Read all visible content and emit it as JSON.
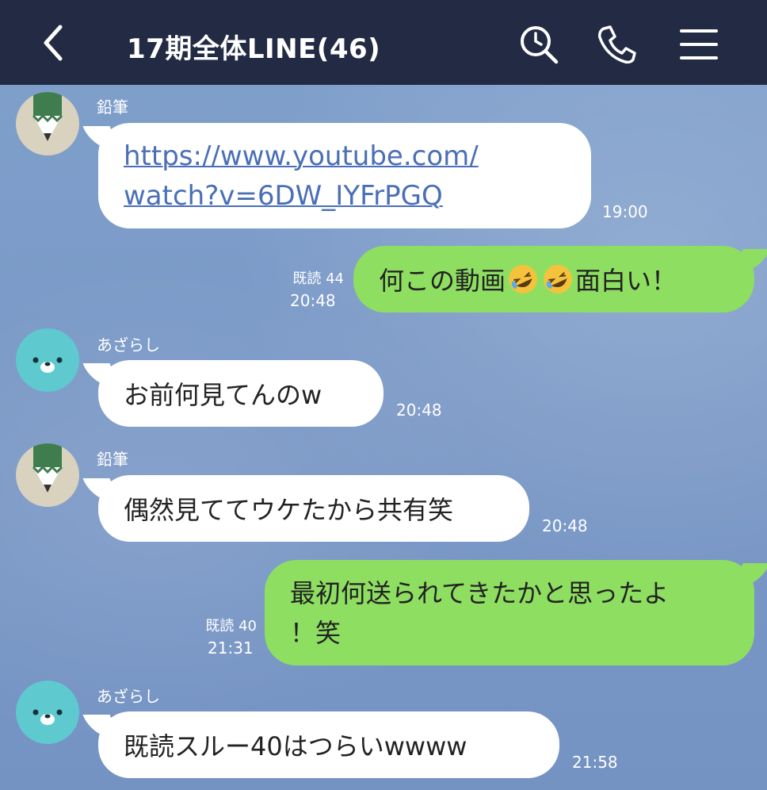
{
  "header": {
    "title": "17期全体LINE(46)",
    "icons": [
      "back-chevron-icon",
      "search-icon",
      "phone-icon",
      "menu-icon"
    ]
  },
  "colors": {
    "header_bg": "#232b44",
    "chat_bg": "#7b9bc9",
    "incoming_bubble": "#ffffff",
    "outgoing_bubble": "#8ede62",
    "link": "#4a6fb6"
  },
  "messages": [
    {
      "sender": "鉛筆",
      "avatar": "pencil-icon",
      "text_line1": "https://www.youtube.com/",
      "text_line2": "watch?v=6DW_IYFrPGQ",
      "time": "19:00"
    },
    {
      "text_before": "何この動画",
      "emoji": "rolling-on-floor-laughing-emoji",
      "text_after": "面白い！",
      "read": "既読 44",
      "time": "20:48"
    },
    {
      "sender": "あざらし",
      "avatar": "seal-icon",
      "text": "お前何見てんのw",
      "time": "20:48"
    },
    {
      "sender": "鉛筆",
      "avatar": "pencil-icon",
      "text": "偶然見ててウケたから共有笑",
      "time": "20:48"
    },
    {
      "text_line1": "最初何送られてきたかと思ったよ",
      "text_line2": "！笑",
      "read": "既読 40",
      "time": "21:31"
    },
    {
      "sender": "あざらし",
      "avatar": "seal-icon",
      "text": "既読スルー40はつらいwwww",
      "time": "21:58"
    }
  ]
}
